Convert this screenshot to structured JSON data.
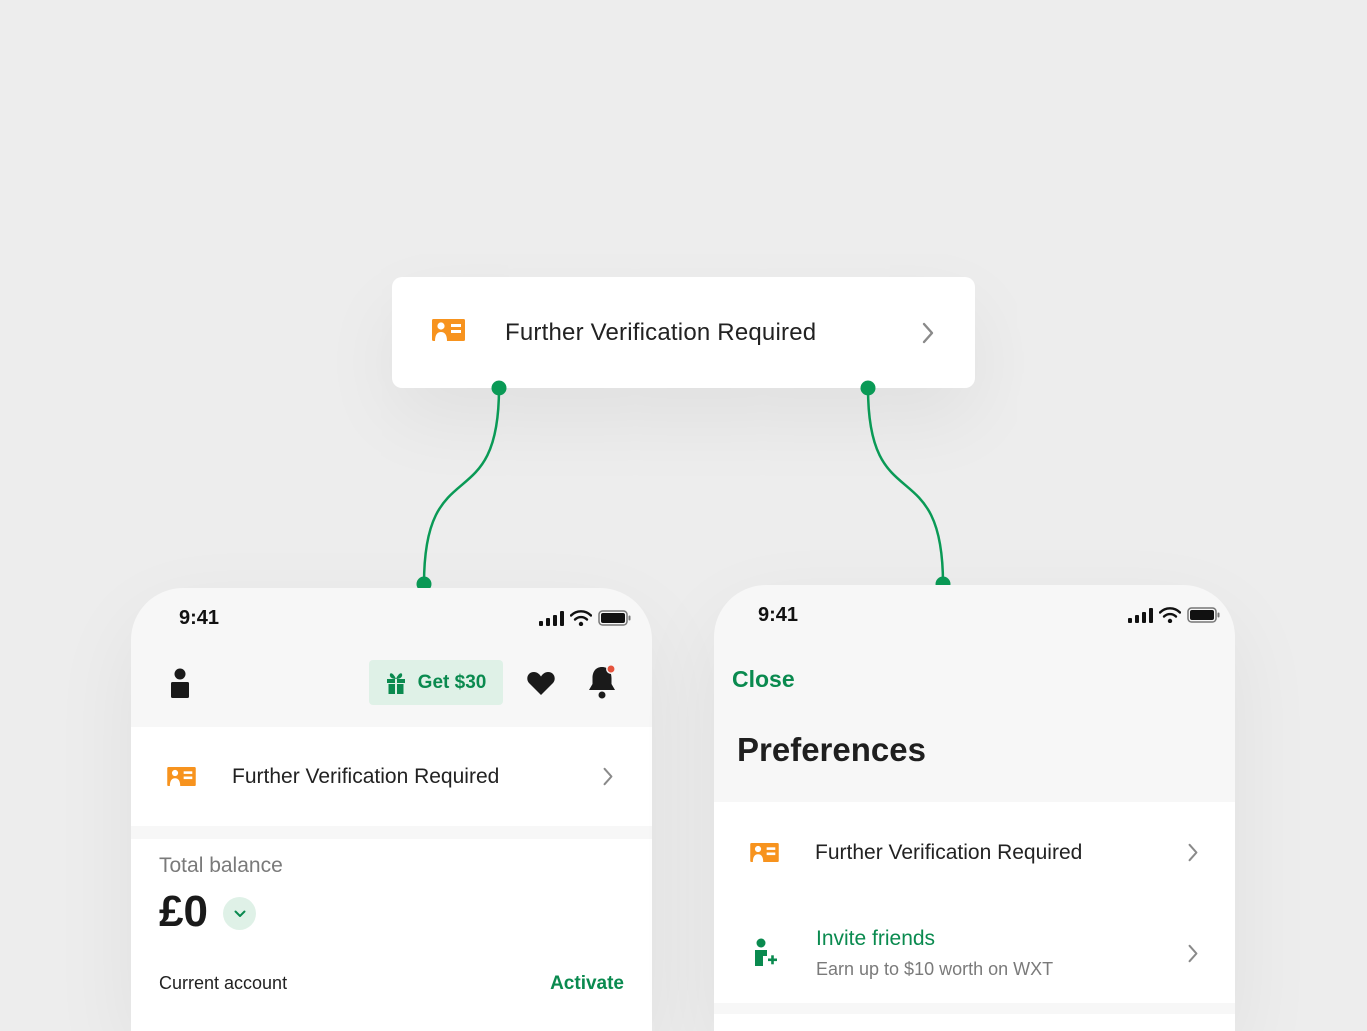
{
  "callout": {
    "label": "Further Verification Required"
  },
  "phone_home": {
    "status_time": "9:41",
    "promo_label": "Get $30",
    "verification_label": "Further Verification Required",
    "balance": {
      "label": "Total balance",
      "value": "£0"
    },
    "account": {
      "label": "Current account",
      "action": "Activate"
    }
  },
  "phone_preferences": {
    "status_time": "9:41",
    "close_label": "Close",
    "title": "Preferences",
    "items": [
      {
        "label": "Further Verification Required"
      },
      {
        "label": "Invite friends",
        "subtitle": "Earn up to $10 worth on WXT"
      }
    ]
  },
  "colors": {
    "accent_green": "#0a8a4f",
    "warning_orange": "#f7931e",
    "notification_red": "#e5533d",
    "promo_bg": "#dff1e7"
  },
  "icons": [
    "id-card-icon",
    "chevron-right-icon",
    "cellular-signal-icon",
    "wifi-icon",
    "battery-icon",
    "user-icon",
    "gift-icon",
    "heart-icon",
    "bell-icon",
    "chevron-down-icon",
    "add-user-icon"
  ]
}
